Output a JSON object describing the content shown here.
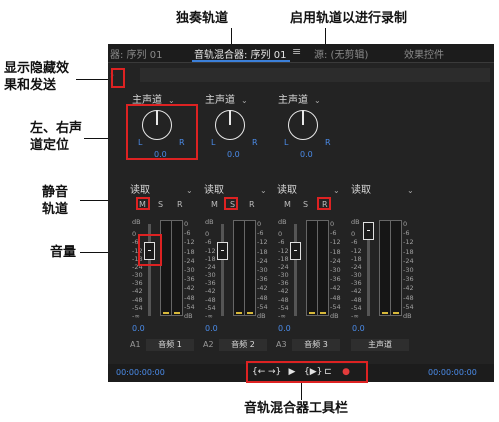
{
  "annotations": {
    "show_hide": [
      "显示隐藏效",
      "果和发送"
    ],
    "pan": [
      "左、右声",
      "道定位"
    ],
    "mute": [
      "静音",
      "轨道"
    ],
    "volume": "音量",
    "solo": "独奏轨道",
    "record": "启用轨道以进行录制",
    "toolbar": "音轨混合器工具栏"
  },
  "tabs": [
    {
      "label": "器: 序列 01"
    },
    {
      "label": "音轨混合器: 序列 01"
    },
    {
      "label": "源: (无剪辑)"
    },
    {
      "label": "效果控件"
    }
  ],
  "menu_icon": "≡",
  "icons": {
    "show_hide": "chevron-right-icon",
    "menu": "hamburger-menu-icon"
  },
  "channels": [
    {
      "output": "主声道",
      "mode": "读取",
      "pan": "0.0",
      "fader": "0.0",
      "id": "A1",
      "name": "音频 1"
    },
    {
      "output": "主声道",
      "mode": "读取",
      "pan": "0.0",
      "fader": "0.0",
      "id": "A2",
      "name": "音频 2"
    },
    {
      "output": "主声道",
      "mode": "读取",
      "pan": "0.0",
      "fader": "0.0",
      "id": "A3",
      "name": "音频 3"
    },
    {
      "output": "",
      "mode": "读取",
      "pan": "",
      "fader": "0.0",
      "id": "",
      "name": "主声道"
    }
  ],
  "knob_labels": {
    "l": "L",
    "r": "R"
  },
  "msr": {
    "m": "M",
    "s": "S",
    "r": "R"
  },
  "db_label": "dB",
  "scale": [
    "6",
    "0",
    "-6",
    "-12",
    "-18",
    "-24",
    "-30",
    "-36",
    "-42",
    "-48",
    "-54",
    "-∞"
  ],
  "meter_scale": [
    "0",
    "-6",
    "-12",
    "-18",
    "-24",
    "-30",
    "-36",
    "-42",
    "-48",
    "-54",
    "dB"
  ],
  "timecode_left": "00:00:00:00",
  "timecode_right": "00:00:00:00",
  "toolbar_buttons": [
    "{←",
    "→}",
    "▶",
    "{▶}",
    "⊏",
    "●"
  ],
  "colors": {
    "panel": "#232323",
    "accent": "#4a8be8",
    "highlight": "#d22222",
    "record": "#e23b3b"
  }
}
